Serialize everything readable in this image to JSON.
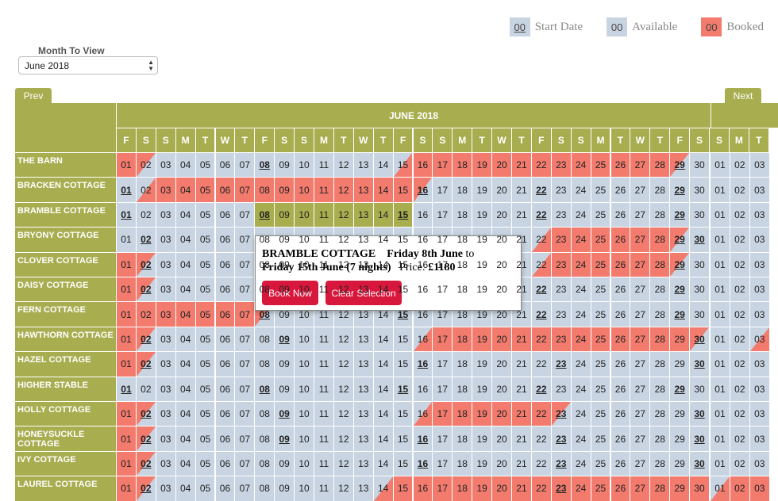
{
  "legend": {
    "start": {
      "swatch": "00",
      "label": "Start Date"
    },
    "available": {
      "swatch": "00",
      "label": "Available"
    },
    "booked": {
      "swatch": "00",
      "label": "Booked"
    }
  },
  "month_select": {
    "label": "Month To View",
    "value": "June 2018"
  },
  "nav": {
    "prev": "Prev",
    "next": "Next"
  },
  "calendar": {
    "month_title": "JUNE 2018",
    "days_of_week": [
      "F",
      "S",
      "S",
      "M",
      "T",
      "W",
      "T",
      "F",
      "S",
      "S",
      "M",
      "T",
      "W",
      "T",
      "F",
      "S",
      "S",
      "M",
      "T",
      "W",
      "T",
      "F",
      "S",
      "S",
      "M",
      "T",
      "W",
      "T",
      "F",
      "S",
      "S",
      "M",
      "T"
    ],
    "colors": {
      "available": "#c8d4e2",
      "booked": "#f27b6e",
      "selected": "#a8ad4f",
      "header": "#a8ad4f",
      "button": "#d8173c"
    },
    "rows": [
      {
        "name": "THE BARN",
        "booked": [
          1,
          2,
          15,
          16,
          17,
          18,
          19,
          20,
          21,
          22,
          23,
          24,
          25,
          26,
          27,
          28,
          29
        ],
        "tend": [
          2
        ],
        "tstart": [
          15
        ],
        "tend2": [
          29
        ],
        "bold": [
          8,
          29
        ],
        "july": {
          "b": [],
          "bold": []
        }
      },
      {
        "name": "BRACKEN COTTAGE",
        "booked": [
          2,
          3,
          4,
          5,
          6,
          7,
          8,
          9,
          10,
          11,
          12,
          13,
          14,
          15,
          16
        ],
        "tstart": [
          2
        ],
        "tend": [
          16
        ],
        "bold": [
          1,
          16,
          22,
          29
        ],
        "july": {
          "b": [],
          "bold": []
        }
      },
      {
        "name": "BRAMBLE COTTAGE",
        "booked": [],
        "selected": [
          8,
          9,
          10,
          11,
          12,
          13,
          14,
          15
        ],
        "bold": [
          1,
          8,
          15,
          22,
          29
        ],
        "july": {
          "b": [],
          "bold": []
        }
      },
      {
        "name": "BRYONY COTTAGE",
        "booked": [
          22,
          23,
          24,
          25,
          26,
          27,
          28,
          29
        ],
        "tstart": [
          22
        ],
        "tend": [
          29
        ],
        "bold": [
          2,
          29,
          30
        ],
        "july": {
          "b": [],
          "bold": []
        }
      },
      {
        "name": "CLOVER COTTAGE",
        "booked": [
          1,
          2,
          22,
          23,
          24,
          25,
          26,
          27,
          28,
          29
        ],
        "tend": [
          2
        ],
        "tstart": [
          22
        ],
        "tend2": [
          29
        ],
        "bold": [
          2,
          29
        ],
        "july": {
          "b": [],
          "bold": []
        }
      },
      {
        "name": "DAISY COTTAGE",
        "booked": [
          1,
          2
        ],
        "tend": [
          2
        ],
        "bold": [
          2,
          22,
          29
        ],
        "july": {
          "b": [],
          "bold": []
        }
      },
      {
        "name": "FERN COTTAGE",
        "booked": [
          1,
          2,
          3,
          4,
          5,
          6,
          7,
          8
        ],
        "tend": [
          8
        ],
        "bold": [
          8,
          15,
          22,
          29
        ],
        "july": {
          "b": [],
          "bold": []
        }
      },
      {
        "name": "HAWTHORN COTTAGE",
        "booked": [
          1,
          2,
          16,
          17,
          18,
          19,
          20,
          21,
          22,
          23,
          24,
          25,
          26,
          27,
          28,
          29,
          30
        ],
        "tend": [
          2,
          30
        ],
        "tstart": [
          16
        ],
        "bold": [
          2,
          9,
          30
        ],
        "july": {
          "b": [
            3
          ],
          "tstart": [
            3
          ],
          "bold": []
        }
      },
      {
        "name": "HAZEL COTTAGE",
        "booked": [
          1,
          2
        ],
        "tend": [
          2
        ],
        "bold": [
          2,
          16,
          23,
          30
        ],
        "july": {
          "b": [],
          "bold": []
        }
      },
      {
        "name": "HIGHER STABLE",
        "booked": [],
        "bold": [
          1,
          8,
          15,
          22,
          29
        ],
        "july": {
          "b": [],
          "bold": []
        }
      },
      {
        "name": "HOLLY COTTAGE",
        "booked": [
          1,
          2,
          16,
          17,
          18,
          19,
          20,
          21,
          22,
          23
        ],
        "tend": [
          2,
          23
        ],
        "tstart": [
          16
        ],
        "bold": [
          2,
          9,
          23,
          30
        ],
        "july": {
          "b": [],
          "bold": []
        }
      },
      {
        "name": "HONEYSUCKLE COTTAGE",
        "booked": [
          1,
          2
        ],
        "tend": [
          2
        ],
        "bold": [
          2,
          9,
          16,
          23,
          30
        ],
        "july": {
          "b": [],
          "bold": []
        }
      },
      {
        "name": "IVY COTTAGE",
        "booked": [
          1,
          2
        ],
        "tend": [
          2
        ],
        "bold": [
          2,
          16,
          23,
          30
        ],
        "july": {
          "b": [],
          "bold": []
        }
      },
      {
        "name": "LAUREL COTTAGE",
        "booked": [
          1,
          2,
          14,
          15,
          16,
          17,
          18,
          19,
          20,
          21,
          22,
          23,
          24,
          25,
          26,
          27,
          28,
          29,
          30
        ],
        "tend": [
          2
        ],
        "tstart": [
          14
        ],
        "bold": [
          2,
          23
        ],
        "july": {
          "b": [
            1,
            2,
            3
          ],
          "tstart": [
            1
          ],
          "bold": []
        }
      }
    ],
    "july_days": [
      "01",
      "02",
      "03"
    ]
  },
  "popup": {
    "cottage": "BRAMBLE COTTAGE",
    "from": "Friday 8th June",
    "to_word": "to",
    "to": "Friday 15th June",
    "nights": "(7 nights)",
    "price_label": "Price:",
    "price": "£1180",
    "book_now": "Book Now",
    "clear_selection": "Clear Selection"
  }
}
